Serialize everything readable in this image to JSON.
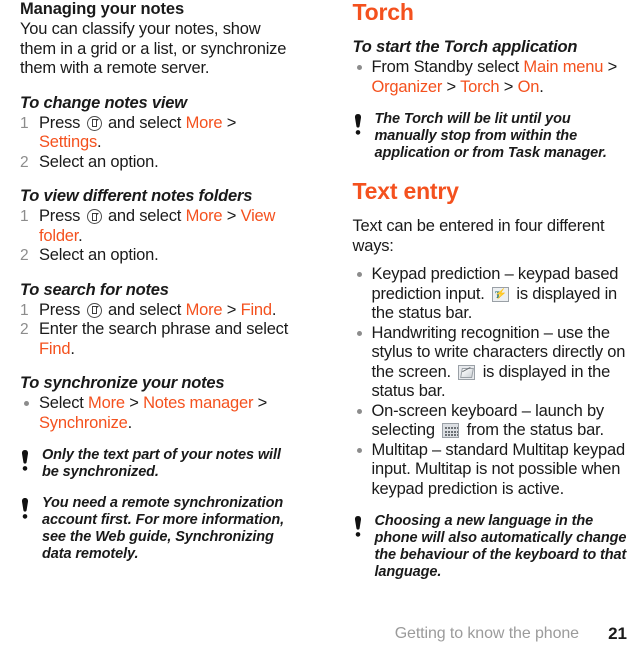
{
  "document": {
    "footer": {
      "breadcrumb": "Getting to know the phone",
      "page_number": "21"
    },
    "accent_color": "#F4511E",
    "number_color": "#8C8C8C",
    "footer_color": "#9B9B9B"
  },
  "left_column": {
    "section_heading": "Managing your notes",
    "intro": "You can classify your notes, show them in a grid or a list, or synchronize them with a remote server.",
    "task_change_view": {
      "heading": "To change notes view",
      "steps": [
        {
          "num": "1",
          "parts": [
            {
              "text": "Press ",
              "style": "plain"
            },
            {
              "text": "notes-icon",
              "style": "icon"
            },
            {
              "text": " and select ",
              "style": "plain"
            },
            {
              "text": "More",
              "style": "orange"
            },
            {
              "text": " > ",
              "style": "plain"
            },
            {
              "text": "Settings",
              "style": "orange"
            },
            {
              "text": ".",
              "style": "plain"
            }
          ]
        },
        {
          "num": "2",
          "parts": [
            {
              "text": "Select an option.",
              "style": "plain"
            }
          ]
        }
      ]
    },
    "task_view_folders": {
      "heading": "To view different notes folders",
      "steps": [
        {
          "num": "1",
          "parts": [
            {
              "text": "Press ",
              "style": "plain"
            },
            {
              "text": "notes-icon",
              "style": "icon"
            },
            {
              "text": " and select ",
              "style": "plain"
            },
            {
              "text": "More",
              "style": "orange"
            },
            {
              "text": " > ",
              "style": "plain"
            },
            {
              "text": "View folder",
              "style": "orange"
            },
            {
              "text": ".",
              "style": "plain"
            }
          ]
        },
        {
          "num": "2",
          "parts": [
            {
              "text": "Select an option.",
              "style": "plain"
            }
          ]
        }
      ]
    },
    "task_search": {
      "heading": "To search for notes",
      "steps": [
        {
          "num": "1",
          "parts": [
            {
              "text": "Press ",
              "style": "plain"
            },
            {
              "text": "notes-icon",
              "style": "icon"
            },
            {
              "text": " and select ",
              "style": "plain"
            },
            {
              "text": "More",
              "style": "orange"
            },
            {
              "text": " > ",
              "style": "plain"
            },
            {
              "text": "Find",
              "style": "orange"
            },
            {
              "text": ".",
              "style": "plain"
            }
          ]
        },
        {
          "num": "2",
          "parts": [
            {
              "text": "Enter the search phrase and select ",
              "style": "plain"
            },
            {
              "text": "Find",
              "style": "orange"
            },
            {
              "text": ".",
              "style": "plain"
            }
          ]
        }
      ]
    },
    "task_synchronize": {
      "heading": "To synchronize your notes",
      "bullets": [
        {
          "parts": [
            {
              "text": "Select ",
              "style": "plain"
            },
            {
              "text": "More",
              "style": "orange"
            },
            {
              "text": " > ",
              "style": "plain"
            },
            {
              "text": "Notes manager",
              "style": "orange"
            },
            {
              "text": " > ",
              "style": "plain"
            },
            {
              "text": "Synchronize",
              "style": "orange"
            },
            {
              "text": ".",
              "style": "plain"
            }
          ]
        }
      ]
    },
    "notes": [
      "Only the text part of your notes will be synchronized.",
      "You need a remote synchronization account first. For more information, see the Web guide, Synchronizing data remotely."
    ]
  },
  "right_column": {
    "torch": {
      "heading": "Torch",
      "task_heading": "To start the Torch application",
      "bullets": [
        {
          "parts": [
            {
              "text": "From Standby select ",
              "style": "plain"
            },
            {
              "text": "Main menu",
              "style": "orange"
            },
            {
              "text": " > ",
              "style": "plain"
            },
            {
              "text": "Organizer",
              "style": "orange"
            },
            {
              "text": " > ",
              "style": "plain"
            },
            {
              "text": "Torch",
              "style": "orange"
            },
            {
              "text": " > ",
              "style": "plain"
            },
            {
              "text": "On",
              "style": "orange"
            },
            {
              "text": ".",
              "style": "plain"
            }
          ]
        }
      ],
      "note": "The Torch will be lit until you manually stop from within the application or from Task manager."
    },
    "text_entry": {
      "heading": "Text entry",
      "intro": "Text can be entered in four different ways:",
      "bullets": [
        {
          "parts": [
            {
              "text": "Keypad prediction – keypad based prediction input. ",
              "style": "plain"
            },
            {
              "text": "keypad-prediction-icon",
              "style": "icon"
            },
            {
              "text": " is displayed in the status bar.",
              "style": "plain"
            }
          ]
        },
        {
          "parts": [
            {
              "text": "Handwriting recognition – use the stylus to write characters directly on the screen. ",
              "style": "plain"
            },
            {
              "text": "stylus-pen-icon",
              "style": "icon"
            },
            {
              "text": " is displayed in the status bar.",
              "style": "plain"
            }
          ]
        },
        {
          "parts": [
            {
              "text": "On-screen keyboard – launch by selecting ",
              "style": "plain"
            },
            {
              "text": "onscreen-keyboard-icon",
              "style": "icon"
            },
            {
              "text": " from the status bar.",
              "style": "plain"
            }
          ]
        },
        {
          "parts": [
            {
              "text": "Multitap – standard Multitap keypad input. Multitap is not possible when keypad prediction is active.",
              "style": "plain"
            }
          ]
        }
      ],
      "note": "Choosing a new language in the phone will also automatically change the behaviour of the keyboard to that language."
    }
  }
}
